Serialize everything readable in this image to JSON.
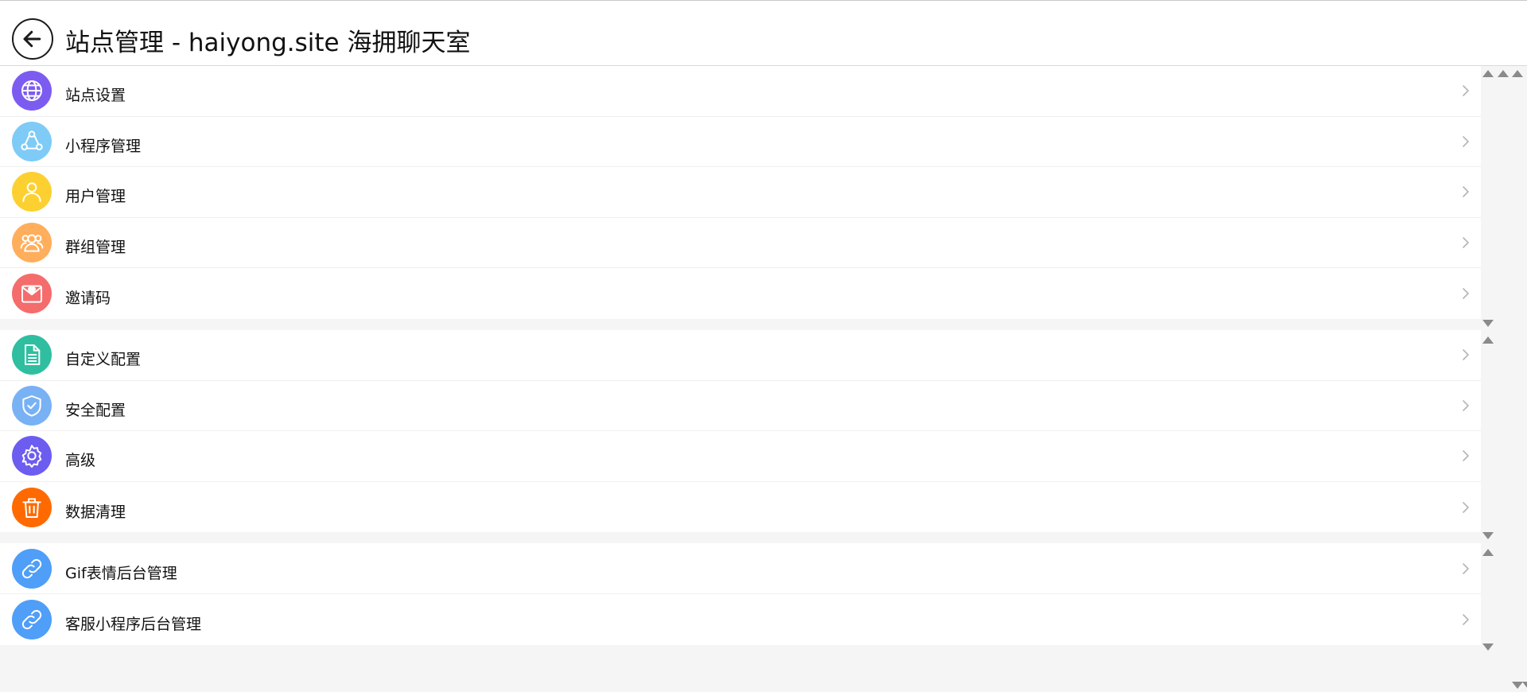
{
  "header": {
    "title": "站点管理 - haiyong.site 海拥聊天室",
    "back_icon": "arrow-left-icon"
  },
  "groups": [
    {
      "items": [
        {
          "label": "站点设置",
          "icon": "globe-icon",
          "color": "#7c5cf0"
        },
        {
          "label": "小程序管理",
          "icon": "share-nodes-icon",
          "color": "#7fcbf7"
        },
        {
          "label": "用户管理",
          "icon": "user-icon",
          "color": "#fcd031"
        },
        {
          "label": "群组管理",
          "icon": "users-icon",
          "color": "#ffae5c"
        },
        {
          "label": "邀请码",
          "icon": "envelope-heart-icon",
          "color": "#f56c6c"
        }
      ]
    },
    {
      "items": [
        {
          "label": "自定义配置",
          "icon": "document-icon",
          "color": "#2fbfa0"
        },
        {
          "label": "安全配置",
          "icon": "shield-check-icon",
          "color": "#79b1f5"
        },
        {
          "label": "高级",
          "icon": "gear-icon",
          "color": "#6c5cf0"
        },
        {
          "label": "数据清理",
          "icon": "trash-icon",
          "color": "#ff6a00"
        }
      ]
    },
    {
      "items": [
        {
          "label": "Gif表情后台管理",
          "icon": "link-icon",
          "color": "#4f9ef8"
        },
        {
          "label": "客服小程序后台管理",
          "icon": "link-icon",
          "color": "#4f9ef8"
        }
      ]
    }
  ],
  "chevron_icon": "chevron-right-icon"
}
